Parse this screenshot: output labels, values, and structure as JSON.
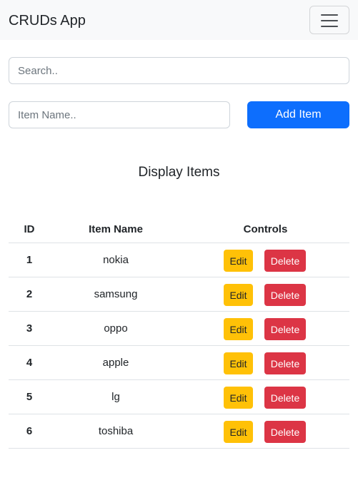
{
  "navbar": {
    "brand": "CRUDs App",
    "toggler_icon": "hamburger-icon"
  },
  "search": {
    "placeholder": "Search..",
    "value": ""
  },
  "add_form": {
    "placeholder": "Item Name..",
    "value": "",
    "button_label": "Add Item"
  },
  "section_title": "Display Items",
  "table": {
    "headers": {
      "id": "ID",
      "name": "Item Name",
      "controls": "Controls"
    },
    "edit_label": "Edit",
    "delete_label": "Delete",
    "rows": [
      {
        "id": "1",
        "name": "nokia"
      },
      {
        "id": "2",
        "name": "samsung"
      },
      {
        "id": "3",
        "name": "oppo"
      },
      {
        "id": "4",
        "name": "apple"
      },
      {
        "id": "5",
        "name": "lg"
      },
      {
        "id": "6",
        "name": "toshiba"
      }
    ]
  },
  "colors": {
    "primary": "#0d6efd",
    "warning": "#ffc107",
    "danger": "#dc3545",
    "navbar_bg": "#f8f9fa"
  }
}
